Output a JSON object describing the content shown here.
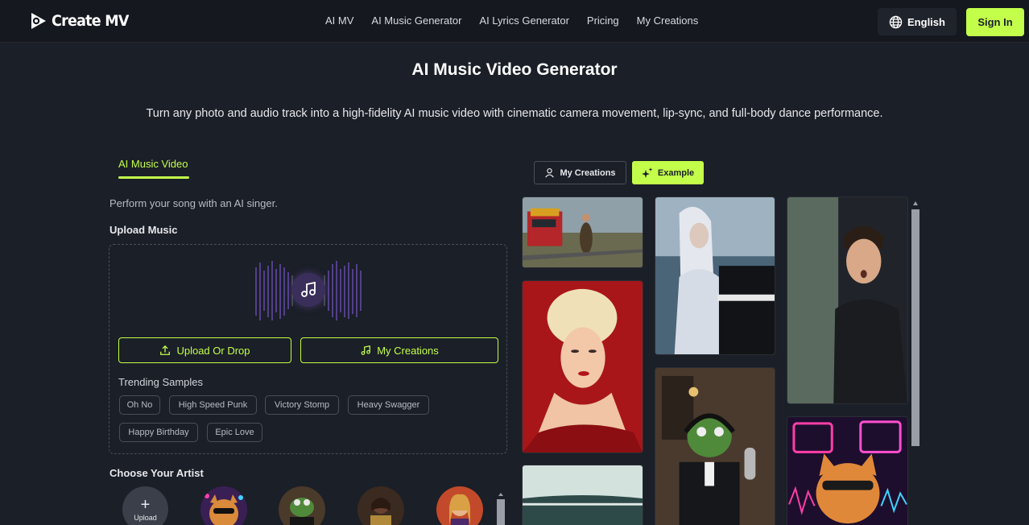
{
  "header": {
    "logo_text": "Create MV",
    "nav": [
      "AI MV",
      "AI Music Generator",
      "AI Lyrics Generator",
      "Pricing",
      "My Creations"
    ],
    "language": "English",
    "sign_in": "Sign In"
  },
  "hero": {
    "title": "AI Music Video Generator",
    "subtitle": "Turn any photo and audio track into a high-fidelity AI music video with cinematic camera movement, lip-sync, and full-body dance performance."
  },
  "form": {
    "tab": "AI Music Video",
    "description": "Perform your song with an AI singer.",
    "upload_music_label": "Upload Music",
    "upload_button": "Upload Or Drop",
    "my_creations_button": "My Creations",
    "trending_label": "Trending Samples",
    "trending": [
      "Oh No",
      "High Speed Punk",
      "Victory Stomp",
      "Heavy Swagger",
      "Happy Birthday",
      "Epic Love"
    ],
    "choose_artist_label": "Choose Your Artist",
    "upload_artist": "Upload"
  },
  "gallery": {
    "my_creations": "My Creations",
    "example": "Example"
  },
  "colors": {
    "accent": "#c3ff4a",
    "background": "#1b1f27",
    "header": "#15181f"
  }
}
